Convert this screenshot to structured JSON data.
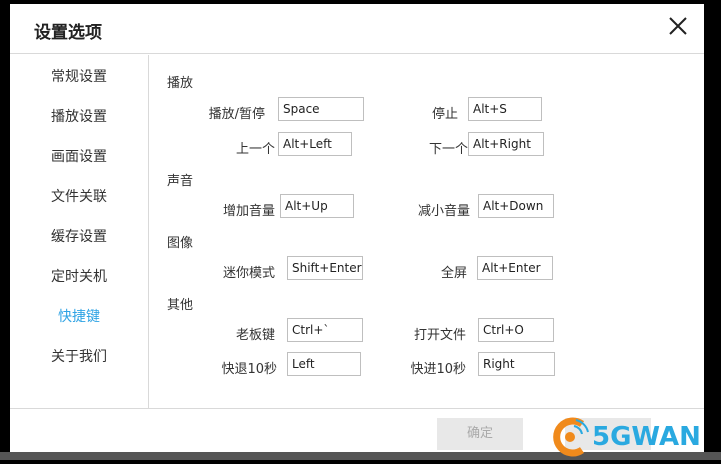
{
  "dialog": {
    "title": "设置选项",
    "close_icon": "close-icon"
  },
  "sidebar": {
    "items": [
      {
        "label": "常规设置",
        "active": false
      },
      {
        "label": "播放设置",
        "active": false
      },
      {
        "label": "画面设置",
        "active": false
      },
      {
        "label": "文件关联",
        "active": false
      },
      {
        "label": "缓存设置",
        "active": false
      },
      {
        "label": "定时关机",
        "active": false
      },
      {
        "label": "快捷键",
        "active": true
      },
      {
        "label": "关于我们",
        "active": false
      }
    ],
    "active_color": "#2fa3e4"
  },
  "sections": {
    "playback": "播放",
    "sound": "声音",
    "image": "图像",
    "other": "其他"
  },
  "shortcuts": {
    "play_pause": {
      "label": "播放/暂停",
      "value": "Space"
    },
    "stop": {
      "label": "停止",
      "value": "Alt+S"
    },
    "prev": {
      "label": "上一个",
      "value": "Alt+Left"
    },
    "next": {
      "label": "下一个",
      "value": "Alt+Right"
    },
    "vol_up": {
      "label": "增加音量",
      "value": "Alt+Up"
    },
    "vol_down": {
      "label": "减小音量",
      "value": "Alt+Down"
    },
    "mini_mode": {
      "label": "迷你模式",
      "value": "Shift+Enter"
    },
    "fullscreen": {
      "label": "全屏",
      "value": "Alt+Enter"
    },
    "boss_key": {
      "label": "老板键",
      "value": "Ctrl+`"
    },
    "open_file": {
      "label": "打开文件",
      "value": "Ctrl+O"
    },
    "rewind": {
      "label": "快退10秒",
      "value": "Left"
    },
    "forward": {
      "label": "快进10秒",
      "value": "Right"
    }
  },
  "footer": {
    "ok_label": "确定",
    "cancel_label": ""
  },
  "watermark": {
    "text": "5GWAN"
  }
}
